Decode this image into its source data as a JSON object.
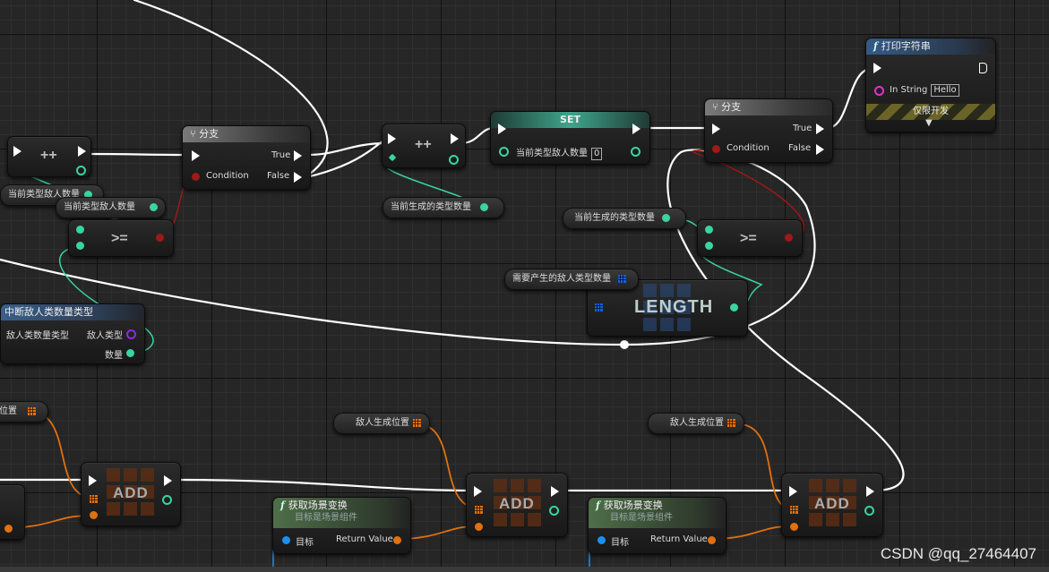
{
  "nodes": {
    "increment_left": {
      "op": "++"
    },
    "branch_left": {
      "title": "分支",
      "true_label": "True",
      "false_label": "False",
      "condition_label": "Condition"
    },
    "var_current_enemy_a": {
      "label": "当前类型敌人数量"
    },
    "var_current_enemy_b": {
      "label": "当前类型敌人数量"
    },
    "compare_left": {
      "op": ">="
    },
    "break_struct": {
      "title": "中断敌人类数量类型",
      "pin_type_in": "敌人类数量类型",
      "pin_type_out": "敌人类型",
      "pin_count_out": "数量"
    },
    "increment_mid": {
      "op": "++"
    },
    "var_generated_mid": {
      "label": "当前生成的类型数量"
    },
    "set_node": {
      "title": "SET",
      "var_label": "当前类型敌人数量",
      "value": "0"
    },
    "branch_right": {
      "title": "分支",
      "true_label": "True",
      "false_label": "False",
      "condition_label": "Condition"
    },
    "print_string": {
      "title": "打印字符串",
      "in_string_label": "In String",
      "in_string_value": "Hello",
      "dev_only": "仅限开发"
    },
    "var_generated_right": {
      "label": "当前生成的类型数量"
    },
    "compare_right": {
      "op": ">="
    },
    "var_required_types": {
      "label": "需要产生的敌人类型数量"
    },
    "length_node": {
      "label": "LENGTH"
    },
    "var_spawn_pos_left": {
      "label": "位置"
    },
    "var_spawn_pos_mid": {
      "label": "敌人生成位置"
    },
    "var_spawn_pos_right": {
      "label": "敌人生成位置"
    },
    "add_left": {
      "label": "ADD"
    },
    "add_mid": {
      "label": "ADD"
    },
    "add_right": {
      "label": "ADD"
    },
    "get_transform_a": {
      "title": "获取场景变换",
      "subtitle": "目标是场景组件",
      "target_label": "目标",
      "return_label": "Return Value"
    },
    "get_transform_b": {
      "title": "获取场景变换",
      "subtitle": "目标是场景组件",
      "target_label": "目标",
      "return_label": "Return Value"
    }
  },
  "watermark": "CSDN @qq_27464407",
  "colors": {
    "exec_wire": "#ffffff",
    "float_wire": "#3ad4a0",
    "bool_wire": "#a01818",
    "array_wire": "#e07010",
    "byte_pin": "#8a2be2",
    "string_pin": "#e033c8",
    "object_pin": "#1c8ff0"
  }
}
